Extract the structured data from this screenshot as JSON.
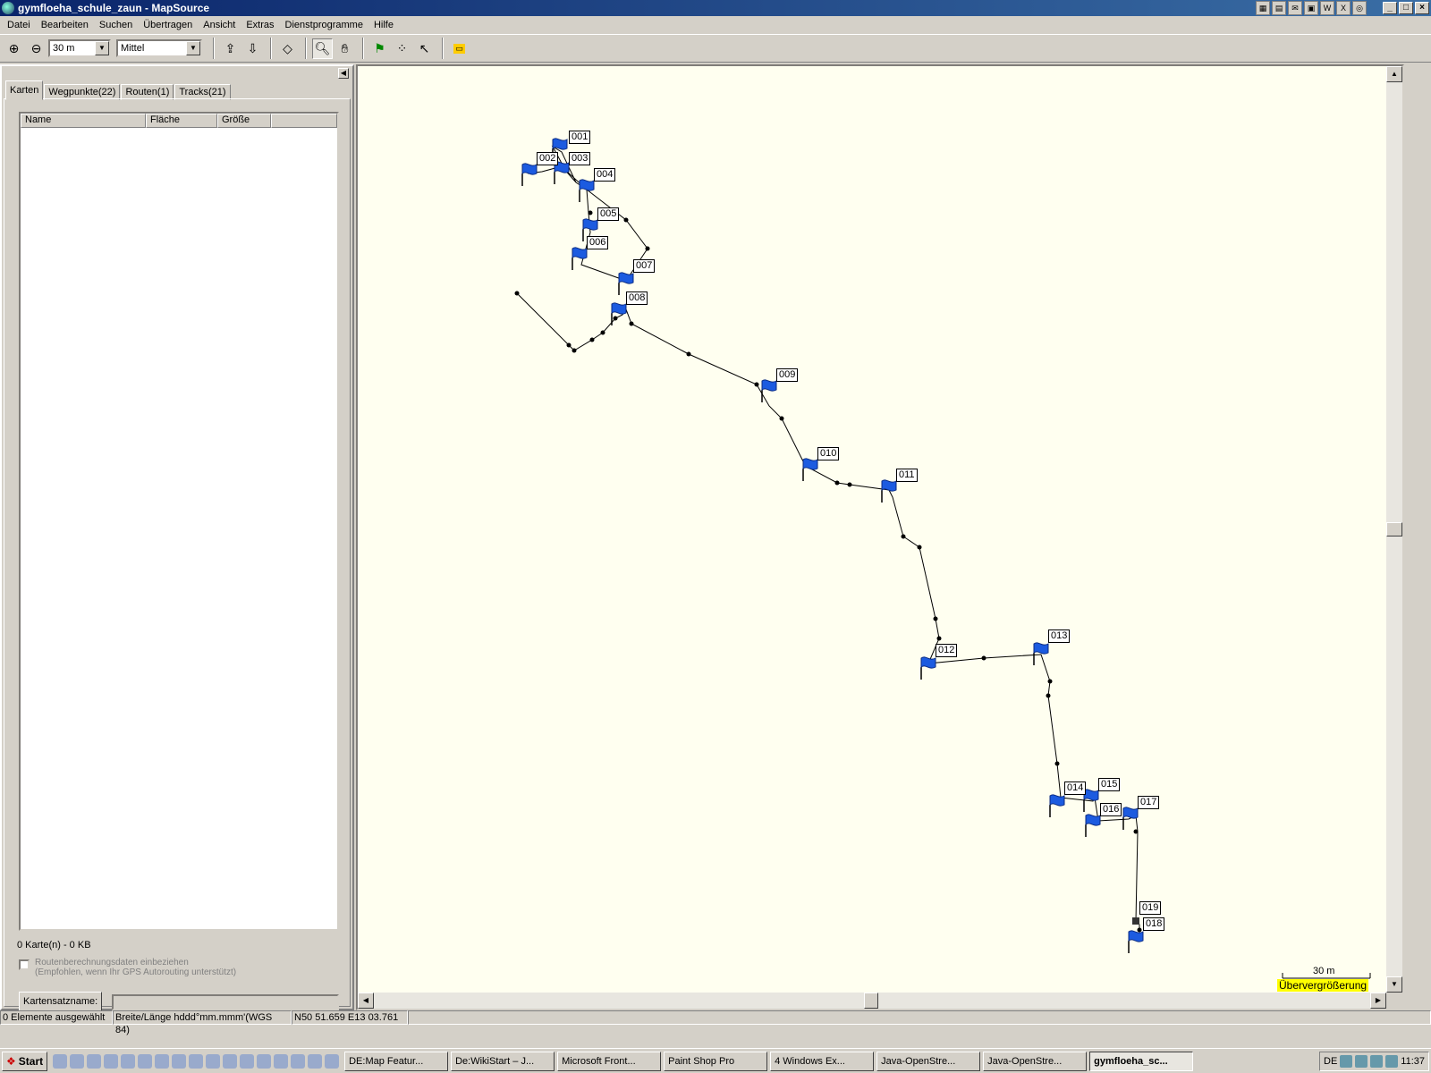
{
  "window": {
    "title": "gymfloeha_schule_zaun - MapSource"
  },
  "menu": [
    "Datei",
    "Bearbeiten",
    "Suchen",
    "Übertragen",
    "Ansicht",
    "Extras",
    "Dienstprogramme",
    "Hilfe"
  ],
  "toolbar": {
    "zoom_value": "30 m",
    "detail_value": "Mittel"
  },
  "tabs": [
    "Karten",
    "Wegpunkte(22)",
    "Routen(1)",
    "Tracks(21)"
  ],
  "columns": [
    "Name",
    "Fläche",
    "Größe"
  ],
  "left_footer": {
    "summary": "0 Karte(n) - 0 KB",
    "checkbox_line1": "Routenberechnungsdaten einbeziehen",
    "checkbox_line2": "(Empfohlen, wenn Ihr GPS Autorouting unterstützt)",
    "button": "Kartensatzname:"
  },
  "map": {
    "scale_label": "30 m",
    "overzoom": "Übervergrößerung",
    "waypoint_labels": [
      "001",
      "002",
      "003",
      "004",
      "005",
      "006",
      "007",
      "008",
      "009",
      "010",
      "011",
      "012",
      "013",
      "014",
      "015",
      "016",
      "017",
      "019",
      "018"
    ]
  },
  "status": {
    "selection": "0 Elemente ausgewählt",
    "format": "Breite/Länge hddd°mm.mmm'(WGS 84)",
    "coords": "N50 51.659 E13 03.761"
  },
  "taskbar": {
    "start": "Start",
    "tasks": [
      "DE:Map Featur...",
      "De:WikiStart – J...",
      "Microsoft Front...",
      "Paint Shop Pro",
      "4 Windows Ex...",
      "Java-OpenStre...",
      "Java-OpenStre...",
      "gymfloeha_sc..."
    ],
    "lang": "DE",
    "clock": "11:37"
  }
}
